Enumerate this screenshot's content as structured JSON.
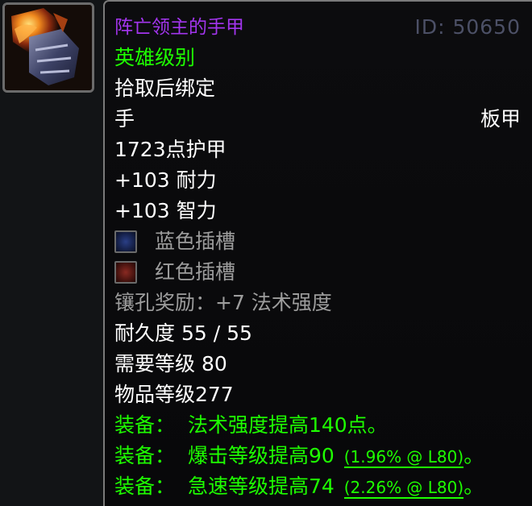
{
  "item": {
    "name": "阵亡领主的手甲",
    "id_text": "ID: 50650",
    "quality": "英雄级别",
    "bind": "拾取后绑定",
    "slot": "手",
    "armor_type": "板甲",
    "armor": "1723点护甲",
    "stat_stamina": "+103 耐力",
    "stat_intellect": "+103 智力",
    "socket_blue": "蓝色插槽",
    "socket_red": "红色插槽",
    "socket_bonus": "镶孔奖励：+7 法术强度",
    "durability": "耐久度 55 / 55",
    "required_level": "需要等级 80",
    "item_level": "物品等级277",
    "equip1_prefix": "装备：",
    "equip1_text": "法术强度提高140点。",
    "equip2_prefix": "装备：",
    "equip2_text": "爆击等级提高90",
    "equip2_note": "(1.96% @ L80)",
    "equip2_end": "。",
    "equip3_prefix": "装备：",
    "equip3_text": "急速等级提高74",
    "equip3_note": "(2.26% @ L80)",
    "equip3_end": "。"
  },
  "colors": {
    "epic": "#a335ee",
    "uncommon_green": "#1eff00",
    "grey_text": "#9d9d9d",
    "id_text": "#4c5066"
  },
  "icons": {
    "item_icon": "gauntlet-icon",
    "socket_blue": "blue-socket-icon",
    "socket_red": "red-socket-icon"
  }
}
